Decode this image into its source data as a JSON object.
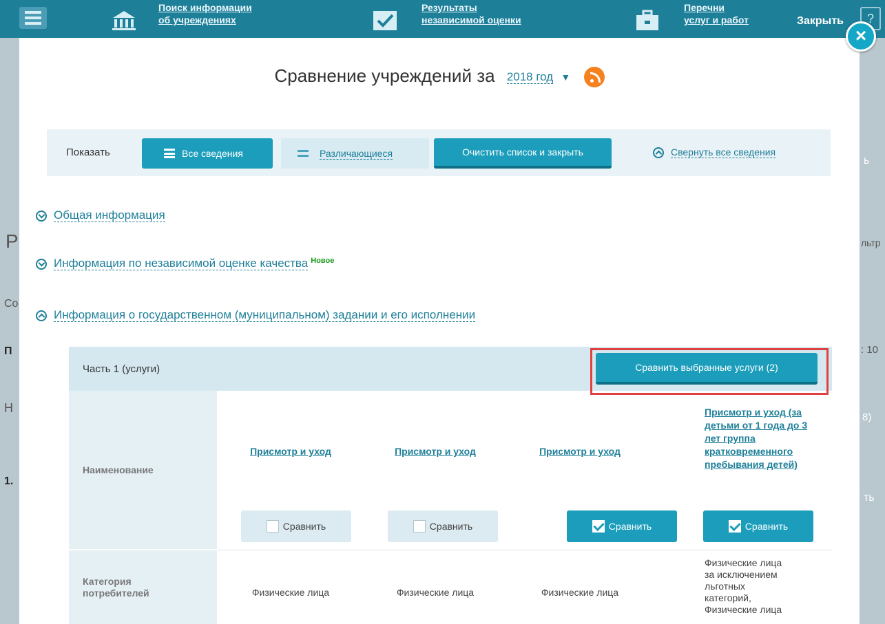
{
  "topbar": {
    "link1": [
      "Поиск информации",
      "об учреждениях"
    ],
    "link2": [
      "Результаты",
      "независимой оценки"
    ],
    "link3": [
      "Перечни",
      "услуг и работ"
    ],
    "close_label": "Закрыть",
    "help_label": "?"
  },
  "modal": {
    "title": "Сравнение учреждений за",
    "year": "2018 год",
    "show_label": "Показать",
    "btn_all": "Все сведения",
    "btn_diff": "Различающиеся",
    "btn_clear": "Очистить список и закрыть",
    "collapse_all": "Свернуть все сведения",
    "close_icon": "×"
  },
  "sections": [
    {
      "label": "Общая информация",
      "state": "collapsed"
    },
    {
      "label": "Информация по независимой оценке качества",
      "badge": "Новое",
      "state": "collapsed"
    },
    {
      "label": "Информация о государственном (муниципальном) задании и его исполнении",
      "state": "expanded"
    }
  ],
  "part": {
    "title": "Часть 1 (услуги)",
    "compare_button": "Сравнить выбранные услуги (2)"
  },
  "table": {
    "row_name_label": "Наименование",
    "row_category_label": [
      "Категория",
      "потребителей"
    ],
    "services": [
      {
        "name": "Присмотр и уход",
        "compare_label": "Сравнить",
        "checked": false,
        "category": "Физические лица"
      },
      {
        "name": "Присмотр и уход",
        "compare_label": "Сравнить",
        "checked": false,
        "category": "Физические лица"
      },
      {
        "name": "Присмотр и уход",
        "compare_label": "Сравнить",
        "checked": true,
        "category": "Физические лица"
      },
      {
        "name_lines": [
          "Присмотр и уход (за",
          "детьми от 1 года до 3",
          "лет группа",
          "кратковременного",
          "пребывания детей)"
        ],
        "compare_label": "Сравнить",
        "checked": true,
        "category_lines": [
          "Физические лица",
          "за исключением",
          "льготных",
          "категорий,",
          "Физические лица"
        ]
      }
    ]
  },
  "background_fragments": {
    "left": [
      "Р",
      "Co",
      "П",
      "Н",
      "1."
    ],
    "right": [
      "ь",
      "льтр",
      ": 10",
      "8)",
      "ть"
    ]
  },
  "colors": {
    "accent": "#1b9dbb",
    "link": "#1e7f99",
    "highlight": "#e04040",
    "badge_new": "#1a9a1a",
    "rss": "#f5821f"
  }
}
